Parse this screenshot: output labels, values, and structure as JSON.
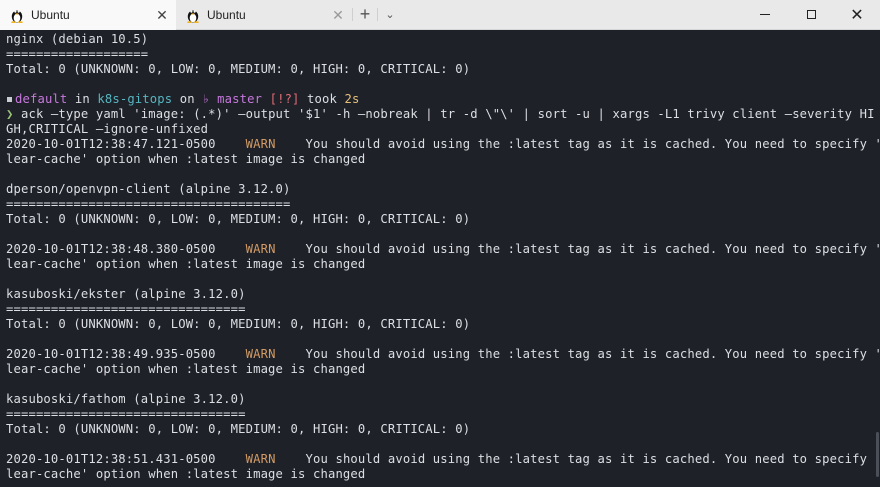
{
  "tabs": [
    {
      "label": "Ubuntu",
      "active": true,
      "icon": "tux-icon"
    },
    {
      "label": "Ubuntu",
      "active": false,
      "icon": "tux-icon"
    }
  ],
  "titlebar": {
    "close_glyph": "✕",
    "new_tab_glyph": "+",
    "dropdown_glyph": "⌄",
    "window_close_glyph": "✕"
  },
  "terminal": {
    "lines": [
      [
        {
          "t": "nginx (debian 10.5)",
          "c": "white"
        }
      ],
      [
        {
          "t": "===================",
          "c": "white"
        }
      ],
      [
        {
          "t": "Total: 0 (UNKNOWN: 0, LOW: 0, MEDIUM: 0, HIGH: 0, CRITICAL: 0)",
          "c": "white"
        }
      ],
      [
        {
          "t": "",
          "c": "white"
        }
      ],
      [
        {
          "t": "bullet",
          "c": "bullet"
        },
        {
          "t": "default",
          "c": "purple"
        },
        {
          "t": " in ",
          "c": "white"
        },
        {
          "t": "k8s-gitops",
          "c": "cyan"
        },
        {
          "t": " on ",
          "c": "white"
        },
        {
          "t": "♭ master",
          "c": "purple"
        },
        {
          "t": " [!?]",
          "c": "red"
        },
        {
          "t": " took ",
          "c": "white"
        },
        {
          "t": "2s",
          "c": "yellow"
        }
      ],
      [
        {
          "t": "❯ ",
          "c": "green"
        },
        {
          "t": "ack —type yaml 'image: (.*)' —output '$1' -h —nobreak | tr -d \\\"\\' | sort -u | xargs -L1 trivy client —severity HI",
          "c": "white"
        }
      ],
      [
        {
          "t": "GH,CRITICAL —ignore-unfixed",
          "c": "white"
        }
      ],
      [
        {
          "t": "2020-10-01T12:38:47.121-0500    ",
          "c": "white"
        },
        {
          "t": "WARN",
          "c": "warn"
        },
        {
          "t": "    You should avoid using the :latest tag as it is cached. You need to specify '—c",
          "c": "white"
        }
      ],
      [
        {
          "t": "lear-cache' option when :latest image is changed",
          "c": "white"
        }
      ],
      [
        {
          "t": "",
          "c": "white"
        }
      ],
      [
        {
          "t": "dperson/openvpn-client (alpine 3.12.0)",
          "c": "white"
        }
      ],
      [
        {
          "t": "======================================",
          "c": "white"
        }
      ],
      [
        {
          "t": "Total: 0 (UNKNOWN: 0, LOW: 0, MEDIUM: 0, HIGH: 0, CRITICAL: 0)",
          "c": "white"
        }
      ],
      [
        {
          "t": "",
          "c": "white"
        }
      ],
      [
        {
          "t": "2020-10-01T12:38:48.380-0500    ",
          "c": "white"
        },
        {
          "t": "WARN",
          "c": "warn"
        },
        {
          "t": "    You should avoid using the :latest tag as it is cached. You need to specify '—c",
          "c": "white"
        }
      ],
      [
        {
          "t": "lear-cache' option when :latest image is changed",
          "c": "white"
        }
      ],
      [
        {
          "t": "",
          "c": "white"
        }
      ],
      [
        {
          "t": "kasuboski/ekster (alpine 3.12.0)",
          "c": "white"
        }
      ],
      [
        {
          "t": "================================",
          "c": "white"
        }
      ],
      [
        {
          "t": "Total: 0 (UNKNOWN: 0, LOW: 0, MEDIUM: 0, HIGH: 0, CRITICAL: 0)",
          "c": "white"
        }
      ],
      [
        {
          "t": "",
          "c": "white"
        }
      ],
      [
        {
          "t": "2020-10-01T12:38:49.935-0500    ",
          "c": "white"
        },
        {
          "t": "WARN",
          "c": "warn"
        },
        {
          "t": "    You should avoid using the :latest tag as it is cached. You need to specify '—c",
          "c": "white"
        }
      ],
      [
        {
          "t": "lear-cache' option when :latest image is changed",
          "c": "white"
        }
      ],
      [
        {
          "t": "",
          "c": "white"
        }
      ],
      [
        {
          "t": "kasuboski/fathom (alpine 3.12.0)",
          "c": "white"
        }
      ],
      [
        {
          "t": "================================",
          "c": "white"
        }
      ],
      [
        {
          "t": "Total: 0 (UNKNOWN: 0, LOW: 0, MEDIUM: 0, HIGH: 0, CRITICAL: 0)",
          "c": "white"
        }
      ],
      [
        {
          "t": "",
          "c": "white"
        }
      ],
      [
        {
          "t": "2020-10-01T12:38:51.431-0500    ",
          "c": "white"
        },
        {
          "t": "WARN",
          "c": "warn"
        },
        {
          "t": "    You should avoid using the :latest tag as it is cached. You need to specify '—c",
          "c": "white"
        }
      ],
      [
        {
          "t": "lear-cache' option when :latest image is changed",
          "c": "white"
        }
      ]
    ]
  },
  "colors": {
    "background": "#1e2127",
    "text": "#dcdfe4",
    "purple": "#c678dd",
    "cyan": "#56b6c2",
    "red": "#e06c75",
    "yellow": "#e5c07b",
    "green": "#98c379",
    "warn": "#d19a66"
  }
}
